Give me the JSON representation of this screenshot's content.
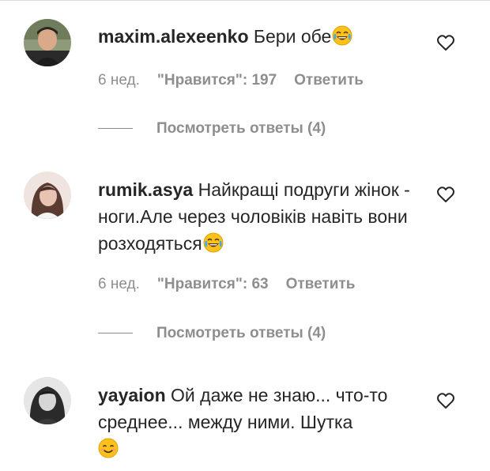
{
  "comments": [
    {
      "username": "maxim.alexeenko",
      "text": "Бери обе",
      "emoji": "face-with-tears-of-joy",
      "time": "6 нед.",
      "likes": "\"Нравится\": 197",
      "reply": "Ответить",
      "view_replies": "Посмотреть ответы (4)"
    },
    {
      "username": "rumik.asya",
      "text": "Найкращі подруги жінок - ноги.Але через чоловіків навіть вони розходяться",
      "emoji": "face-with-tears-of-joy",
      "time": "6 нед.",
      "likes": "\"Нравится\": 63",
      "reply": "Ответить",
      "view_replies": "Посмотреть ответы (4)"
    },
    {
      "username": "yayaion",
      "text": "Ой даже не знаю... что-то среднее... между ними. Шутка",
      "emoji": "smiling-face-with-smiling-eyes"
    }
  ],
  "icons": {
    "like": "heart-outline-icon"
  },
  "colors": {
    "text": "#262626",
    "muted": "#8e8e8e",
    "divider": "#dbdbdb"
  }
}
